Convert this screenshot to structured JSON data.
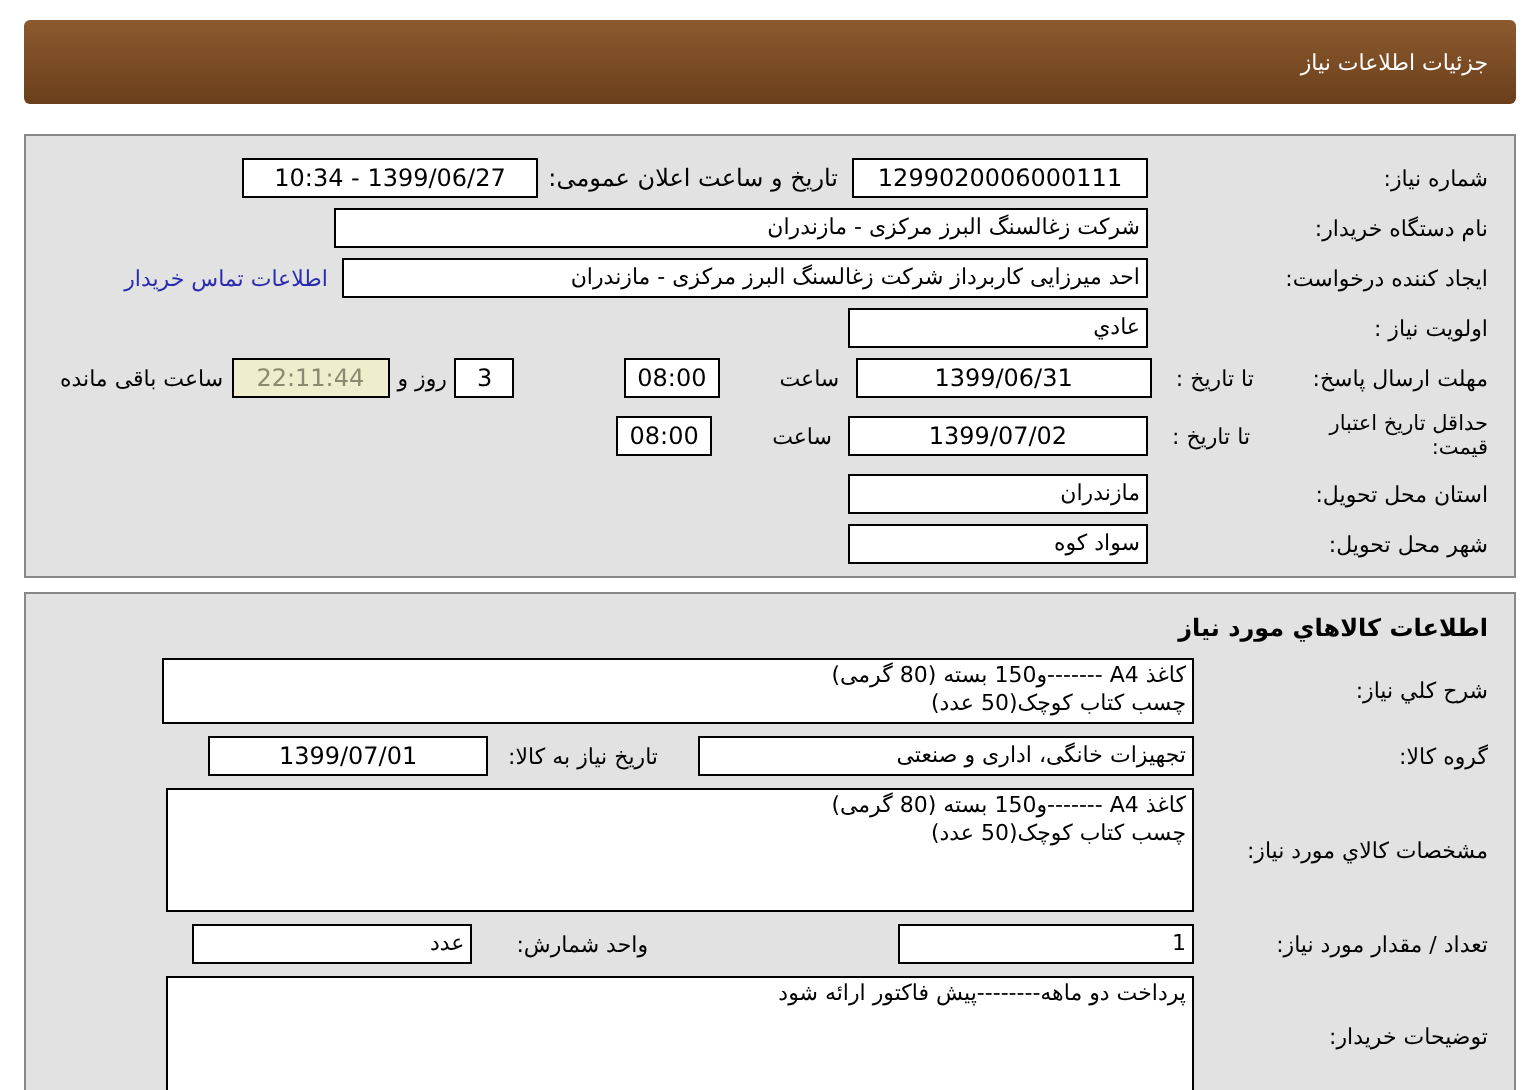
{
  "header": {
    "title": "جزئیات اطلاعات نیاز"
  },
  "details": {
    "need_number": {
      "label": "شماره نیاز:",
      "value": "1299020006000111"
    },
    "announce": {
      "label": "تاریخ و ساعت اعلان عمومی:",
      "value": "1399/06/27 - 10:34"
    },
    "buyer_org": {
      "label": "نام دستگاه خریدار:",
      "value": "شرکت زغالسنگ البرز مرکزی - مازندران"
    },
    "requester": {
      "label": "ایجاد کننده درخواست:",
      "value": "احد میرزایی کاربرداز شرکت زغالسنگ البرز مرکزی - مازندران",
      "contact_link": "اطلاعات تماس خریدار"
    },
    "priority": {
      "label": "اولویت نیاز :",
      "value": "عادي"
    },
    "deadline": {
      "label": "مهلت ارسال پاسخ:",
      "sub_label": "تا تاریخ :",
      "date": "1399/06/31",
      "time_label": "ساعت",
      "time": "08:00",
      "days": "3",
      "days_label": "روز و",
      "remaining": "22:11:44",
      "remaining_label": "ساعت باقی مانده"
    },
    "price_validity": {
      "label": "حداقل تاریخ اعتبار قیمت:",
      "sub_label": "تا تاریخ :",
      "date": "1399/07/02",
      "time_label": "ساعت",
      "time": "08:00"
    },
    "province": {
      "label": "استان محل تحویل:",
      "value": "مازندران"
    },
    "city": {
      "label": "شهر محل تحویل:",
      "value": "سواد کوه"
    }
  },
  "goods": {
    "title": "اطلاعات كالاهاي مورد نياز",
    "description": {
      "label": "شرح کلي نیاز:",
      "lines": [
        "کاغذ A4 -------و150 بسته (80 گرمی)",
        "چسب کتاب کوچک(50 عدد)"
      ]
    },
    "group": {
      "label": "گروه کالا:",
      "value": "تجهیزات خانگی، اداری و صنعتی",
      "need_date_label": "تاریخ نیاز به کالا:",
      "need_date": "1399/07/01"
    },
    "specs": {
      "label": "مشخصات كالاي مورد نياز:",
      "lines": [
        "کاغذ A4 -------و150 بسته (80 گرمی)",
        "چسب کتاب کوچک(50 عدد)"
      ]
    },
    "quantity": {
      "label": "تعداد / مقدار مورد نیاز:",
      "value": "1",
      "unit_label": "واحد شمارش:",
      "unit": "عدد"
    },
    "notes": {
      "label": "توضیحات خریدار:",
      "lines": [
        "پرداخت دو ماهه--------پیش فاکتور ارائه شود"
      ]
    }
  }
}
